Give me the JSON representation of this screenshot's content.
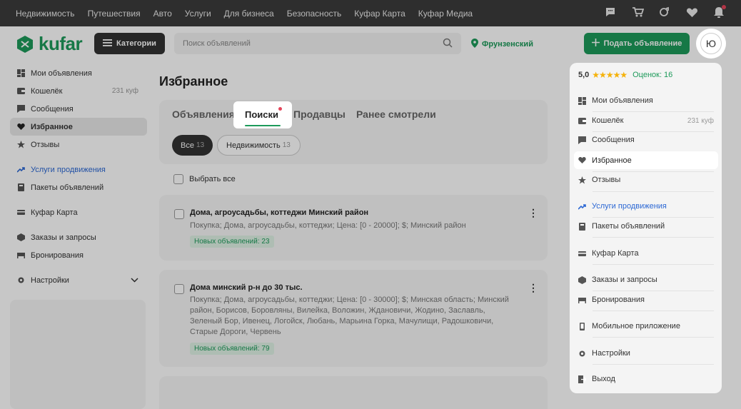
{
  "topbar": {
    "links": [
      "Недвижимость",
      "Путешествия",
      "Авто",
      "Услуги",
      "Для бизнеса",
      "Безопасность",
      "Куфар Карта",
      "Куфар Медиа"
    ],
    "icons": [
      "chat-icon",
      "cart-icon",
      "compare-icon",
      "heart-icon",
      "bell-icon"
    ]
  },
  "header": {
    "logo_text": "kufar",
    "categories_label": "Категории",
    "search_placeholder": "Поиск объявлений",
    "location": "Фрунзенский",
    "post_button": "Подать объявление",
    "avatar_letter": "Ю"
  },
  "sidebar": {
    "items": [
      {
        "label": "Мои объявления",
        "icon": "grid-icon"
      },
      {
        "label": "Кошелёк",
        "icon": "wallet-icon",
        "amount": "231 куф"
      },
      {
        "label": "Сообщения",
        "icon": "chat-icon"
      },
      {
        "label": "Избранное",
        "icon": "heart-icon",
        "active": true
      },
      {
        "label": "Отзывы",
        "icon": "star-icon"
      },
      {
        "label": "Услуги продвижения",
        "icon": "trend-icon",
        "promo": true
      },
      {
        "label": "Пакеты объявлений",
        "icon": "bookmark-icon"
      },
      {
        "label": "Куфар Карта",
        "icon": "card-icon"
      },
      {
        "label": "Заказы и запросы",
        "icon": "box-icon"
      },
      {
        "label": "Бронирования",
        "icon": "bed-icon"
      },
      {
        "label": "Настройки",
        "icon": "gear-icon"
      }
    ]
  },
  "main": {
    "title": "Избранное",
    "tabs": [
      "Объявления",
      "Поиски",
      "Продавцы",
      "Ранее смотрели"
    ],
    "active_tab": "Поиски",
    "filters": [
      {
        "label": "Все",
        "count": "13"
      },
      {
        "label": "Недвижимость",
        "count": "13"
      }
    ],
    "select_all": "Выбрать все",
    "searches": [
      {
        "title": "Дома, агроусадьбы, коттеджи Минский район",
        "description": "Покупка; Дома, агроусадьбы, коттеджи; Цена: [0 - 20000]; $; Минский район",
        "badge": "Новых объявлений: 23"
      },
      {
        "title": "Дома минский р-н до 30 тыс.",
        "description": "Покупка; Дома, агроусадьбы, коттеджи; Цена: [0 - 30000]; $; Минская область; Минский район, Борисов, Боровляны, Вилейка, Воложин, Ждановичи, Жодино, Заславль, Зеленый Бор, Ивенец, Логойск, Любань, Марьина Горка, Мачулищи, Радошковичи, Старые Дороги, Червень",
        "badge": "Новых объявлений: 79"
      }
    ]
  },
  "dropdown": {
    "rating": "5,0",
    "stars": "★★★★★",
    "reviews": "Оценок: 16",
    "items": [
      {
        "label": "Мои объявления",
        "icon": "grid-icon"
      },
      {
        "label": "Кошелёк",
        "icon": "wallet-icon",
        "amount": "231 куф"
      },
      {
        "label": "Сообщения",
        "icon": "chat-icon"
      },
      {
        "label": "Избранное",
        "icon": "heart-icon",
        "highlighted": true
      },
      {
        "label": "Отзывы",
        "icon": "star-icon"
      },
      {
        "label": "Услуги продвижения",
        "icon": "trend-icon",
        "promo": true
      },
      {
        "label": "Пакеты объявлений",
        "icon": "bookmark-icon"
      },
      {
        "label": "Куфар Карта",
        "icon": "card-icon"
      },
      {
        "label": "Заказы и запросы",
        "icon": "box-icon"
      },
      {
        "label": "Бронирования",
        "icon": "bed-icon"
      },
      {
        "label": "Мобильное приложение",
        "icon": "phone-icon"
      },
      {
        "label": "Настройки",
        "icon": "gear-icon"
      },
      {
        "label": "Выход",
        "icon": "logout-icon"
      }
    ]
  },
  "colors": {
    "brand": "#1d9a5a",
    "promo": "#2c68d4",
    "dark": "#333333",
    "topbar": "#3b3b3b",
    "notify": "#e5455a"
  }
}
